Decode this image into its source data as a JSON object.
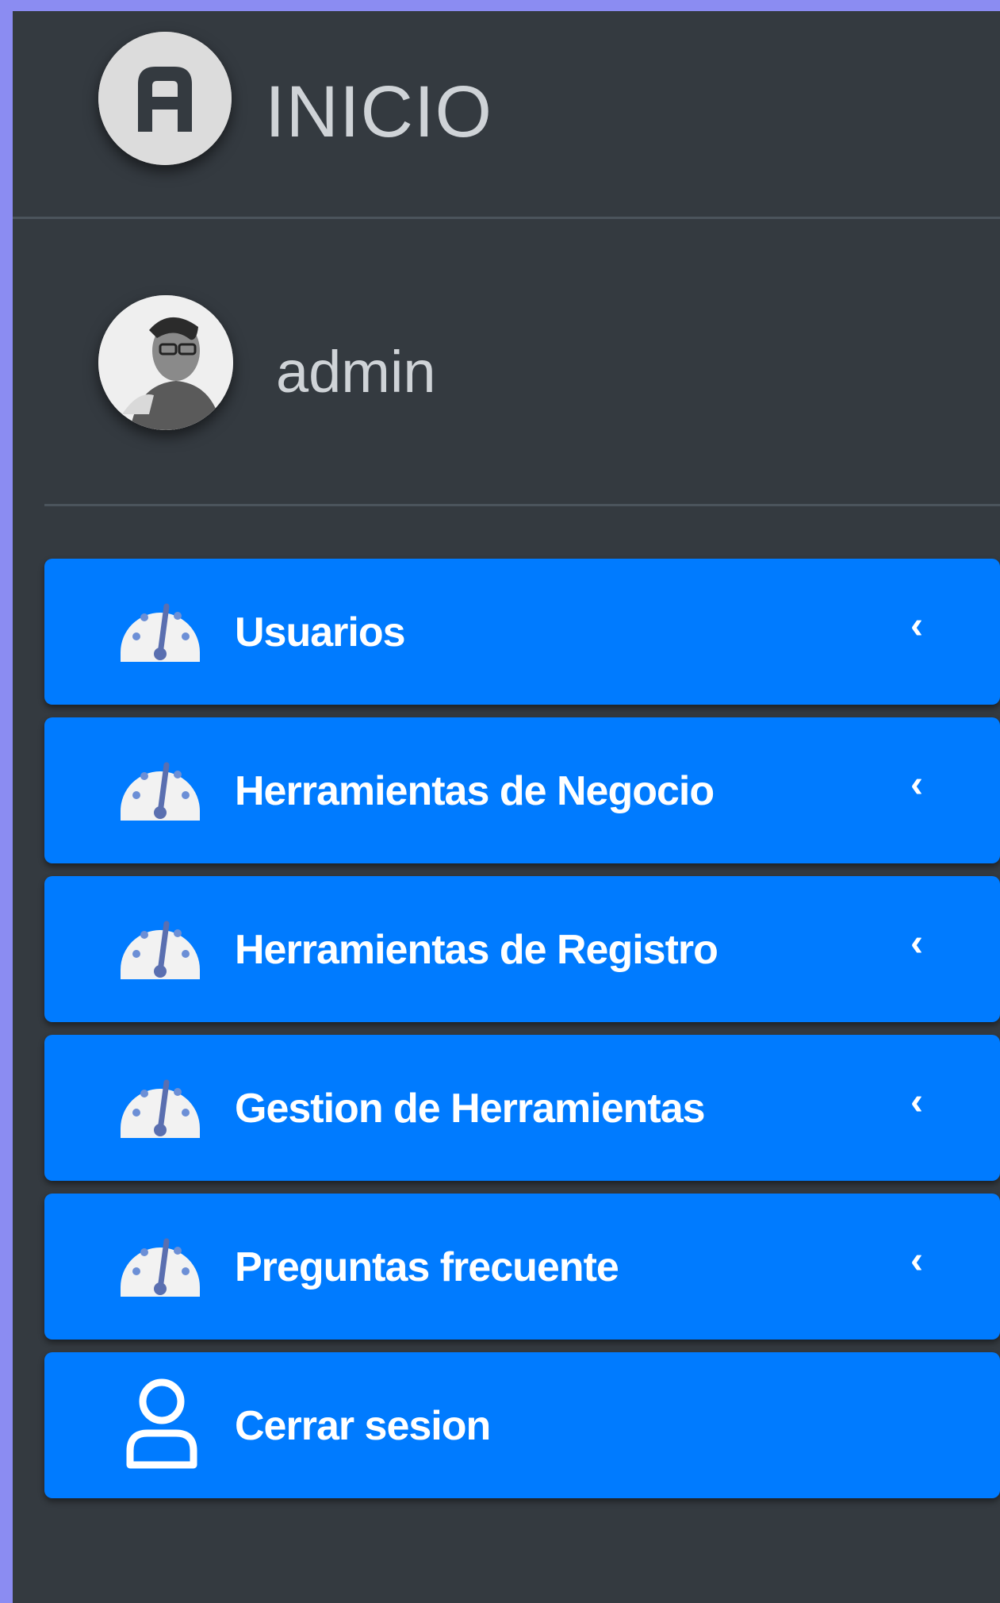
{
  "brand": {
    "title": "INICIO",
    "logo_icon": "circle-a-logo-icon"
  },
  "user": {
    "name": "admin",
    "avatar_icon": "user-avatar"
  },
  "nav": {
    "items": [
      {
        "label": "Usuarios",
        "icon": "tachometer-icon",
        "arrow": "‹"
      },
      {
        "label": "Herramientas de Negocio",
        "icon": "tachometer-icon",
        "arrow": "‹"
      },
      {
        "label": "Herramientas de Registro",
        "icon": "tachometer-icon",
        "arrow": "‹"
      },
      {
        "label": "Gestion de Herramientas",
        "icon": "tachometer-icon",
        "arrow": "‹"
      },
      {
        "label": "Preguntas frecuente",
        "icon": "tachometer-icon",
        "arrow": "‹"
      },
      {
        "label": "Cerrar sesion",
        "icon": "user-outline-icon"
      }
    ]
  },
  "colors": {
    "page_background": "#8b8cf2",
    "sidebar_background": "#343a40",
    "nav_item_background": "#007bff",
    "text_light": "#cfd3d7",
    "divider": "#4b545c"
  }
}
